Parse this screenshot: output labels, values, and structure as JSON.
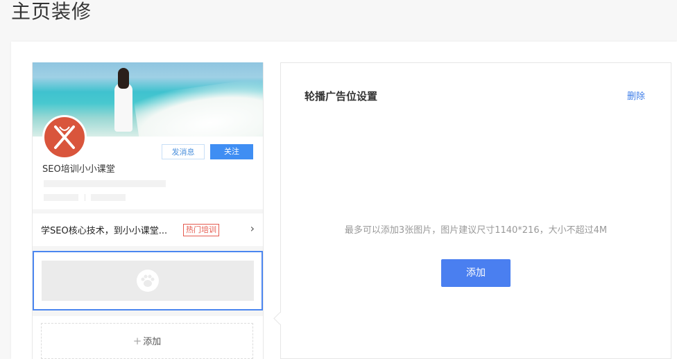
{
  "page": {
    "title": "主页装修"
  },
  "preview": {
    "buttons": {
      "message": "发消息",
      "follow": "关注"
    },
    "shop_name": "SEO培训小小课堂",
    "promo": {
      "text": "学SEO核心技术，到小小课堂...",
      "badge": "热门培训"
    },
    "add_label": "添加"
  },
  "settings": {
    "title": "轮播广告位设置",
    "delete": "删除",
    "hint": "最多可以添加3张图片，图片建议尺寸1140*216，大小不超过4M",
    "add_button": "添加"
  },
  "colors": {
    "accent": "#4a7ff0",
    "badge": "#e55a4e",
    "avatar": "#d9553c"
  }
}
